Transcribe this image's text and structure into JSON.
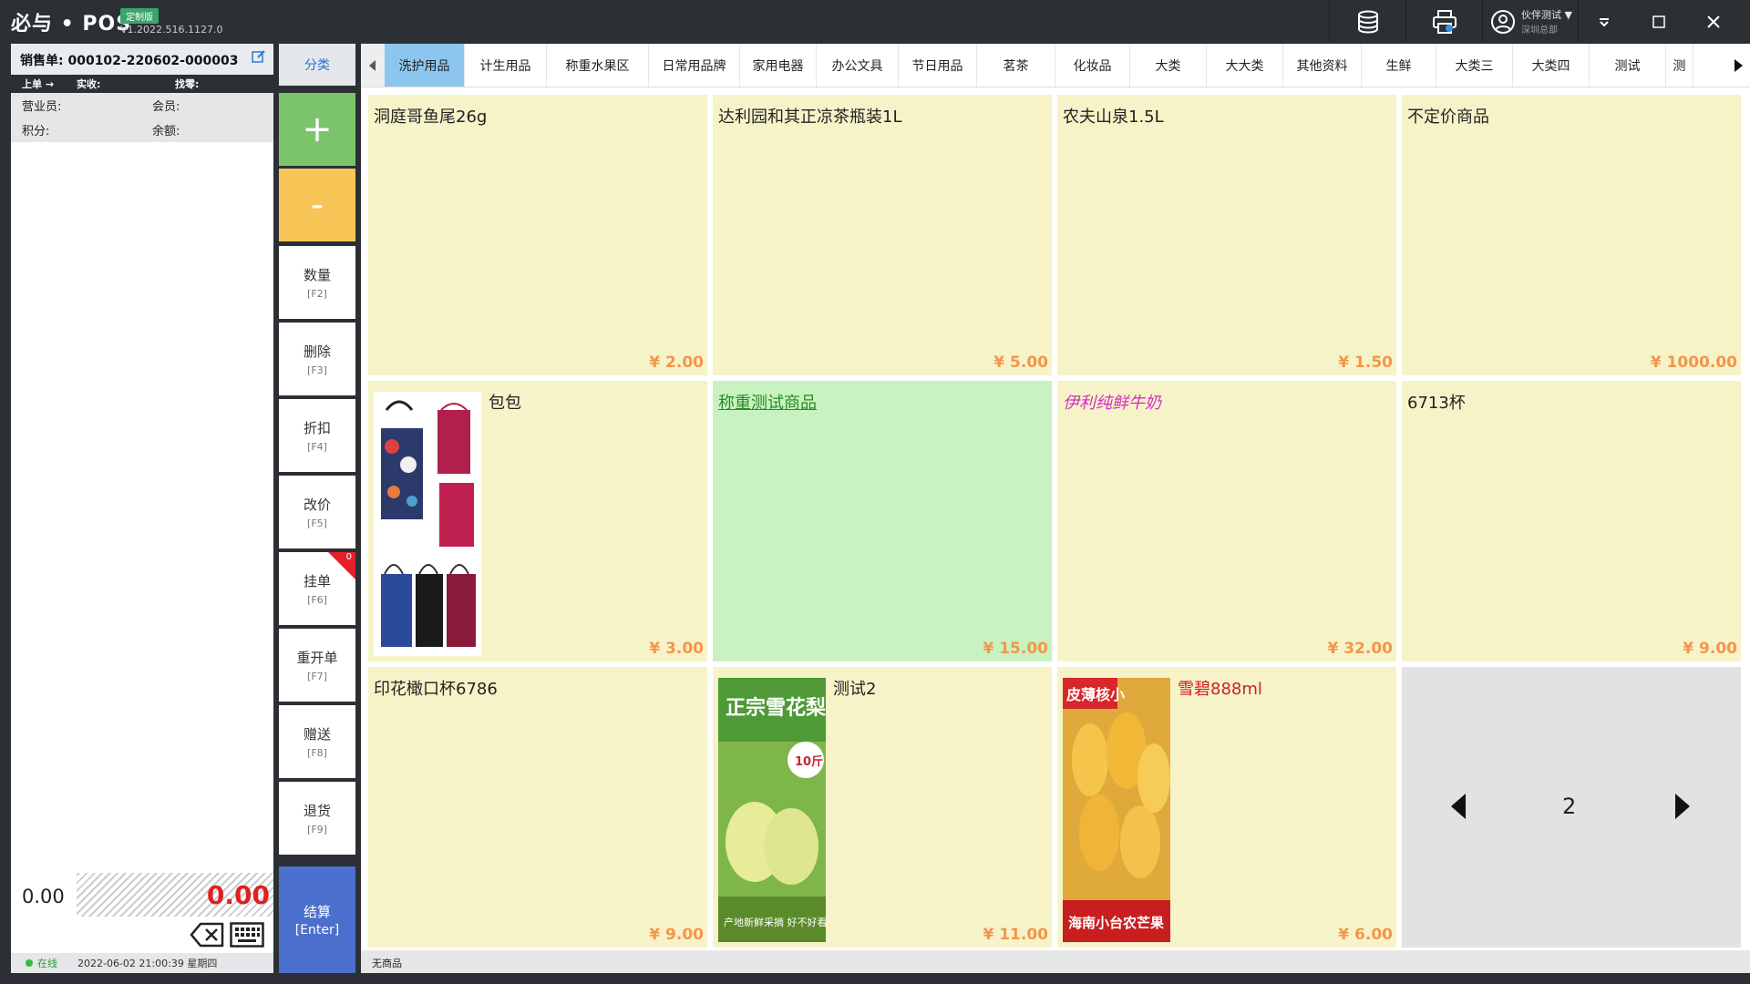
{
  "app": {
    "logo": "必与 • POS",
    "edition": "定制版",
    "version": "V1.2022.516.1127.0",
    "user_name": "伙伴测试 ▼",
    "user_org": "深圳总部"
  },
  "order": {
    "title": "销售单:  000102-220602-000003",
    "summary_labels": [
      "上单 →",
      "实收:",
      "找零:"
    ],
    "cashier_label": "营业员:",
    "member_label": "会员:",
    "points_label": "积分:",
    "balance_label": "余额:",
    "left_total": "0.00",
    "total": "0.00",
    "status_online": "在线",
    "datetime": "2022-06-02 21:00:39 星期四"
  },
  "actions": {
    "category": "分类",
    "plus": "+",
    "minus": "-",
    "quantity": "数量",
    "quantity_key": "[F2]",
    "delete": "删除",
    "delete_key": "[F3]",
    "discount": "折扣",
    "discount_key": "[F4]",
    "reprice": "改价",
    "reprice_key": "[F5]",
    "hold": "挂单",
    "hold_key": "[F6]",
    "hold_badge": "0",
    "reopen": "重开单",
    "reopen_key": "[F7]",
    "gift": "赠送",
    "gift_key": "[F8]",
    "return": "退货",
    "return_key": "[F9]",
    "checkout": "结算",
    "checkout_key": "[Enter]"
  },
  "tabs": [
    {
      "label": "洗护用品",
      "active": true
    },
    {
      "label": "计生用品"
    },
    {
      "label": "称重水果区"
    },
    {
      "label": "日常用品牌"
    },
    {
      "label": "家用电器"
    },
    {
      "label": "办公文具"
    },
    {
      "label": "节日用品"
    },
    {
      "label": "茗茶"
    },
    {
      "label": "化妆品"
    },
    {
      "label": "大类"
    },
    {
      "label": "大大类"
    },
    {
      "label": "其他资料"
    },
    {
      "label": "生鲜"
    },
    {
      "label": "大类三"
    },
    {
      "label": "大类四"
    },
    {
      "label": "测试"
    },
    {
      "label": "测"
    }
  ],
  "products": [
    {
      "name": "洞庭哥鱼尾26g",
      "price": "¥ 2.00"
    },
    {
      "name": "达利园和其正凉茶瓶装1L",
      "price": "¥ 5.00"
    },
    {
      "name": "农夫山泉1.5L",
      "price": "¥ 1.50"
    },
    {
      "name": "不定价商品",
      "price": "¥ 1000.00"
    },
    {
      "name": "包包",
      "price": "¥ 3.00",
      "image": "bag"
    },
    {
      "name": "称重测试商品",
      "price": "¥ 15.00",
      "style": "weighted"
    },
    {
      "name": "伊利纯鲜牛奶",
      "price": "¥ 32.00",
      "style": "promo"
    },
    {
      "name": "6713杯",
      "price": "¥ 9.00"
    },
    {
      "name": "印花橄口杯6786",
      "price": "¥ 9.00"
    },
    {
      "name": "测试2",
      "price": "¥ 11.00",
      "image": "pear"
    },
    {
      "name": "雪碧888ml",
      "price": "¥ 6.00",
      "image": "mango",
      "style": "red"
    }
  ],
  "pager": {
    "page": "2"
  },
  "grid_status": "无商品",
  "colors": {
    "accent_blue": "#4b6fcc",
    "tab_active": "#8cc6ef",
    "card_bg": "#f7f3c8",
    "weighted_bg": "#c8f3c0",
    "price": "#f4964a",
    "total_red": "#e02020"
  }
}
